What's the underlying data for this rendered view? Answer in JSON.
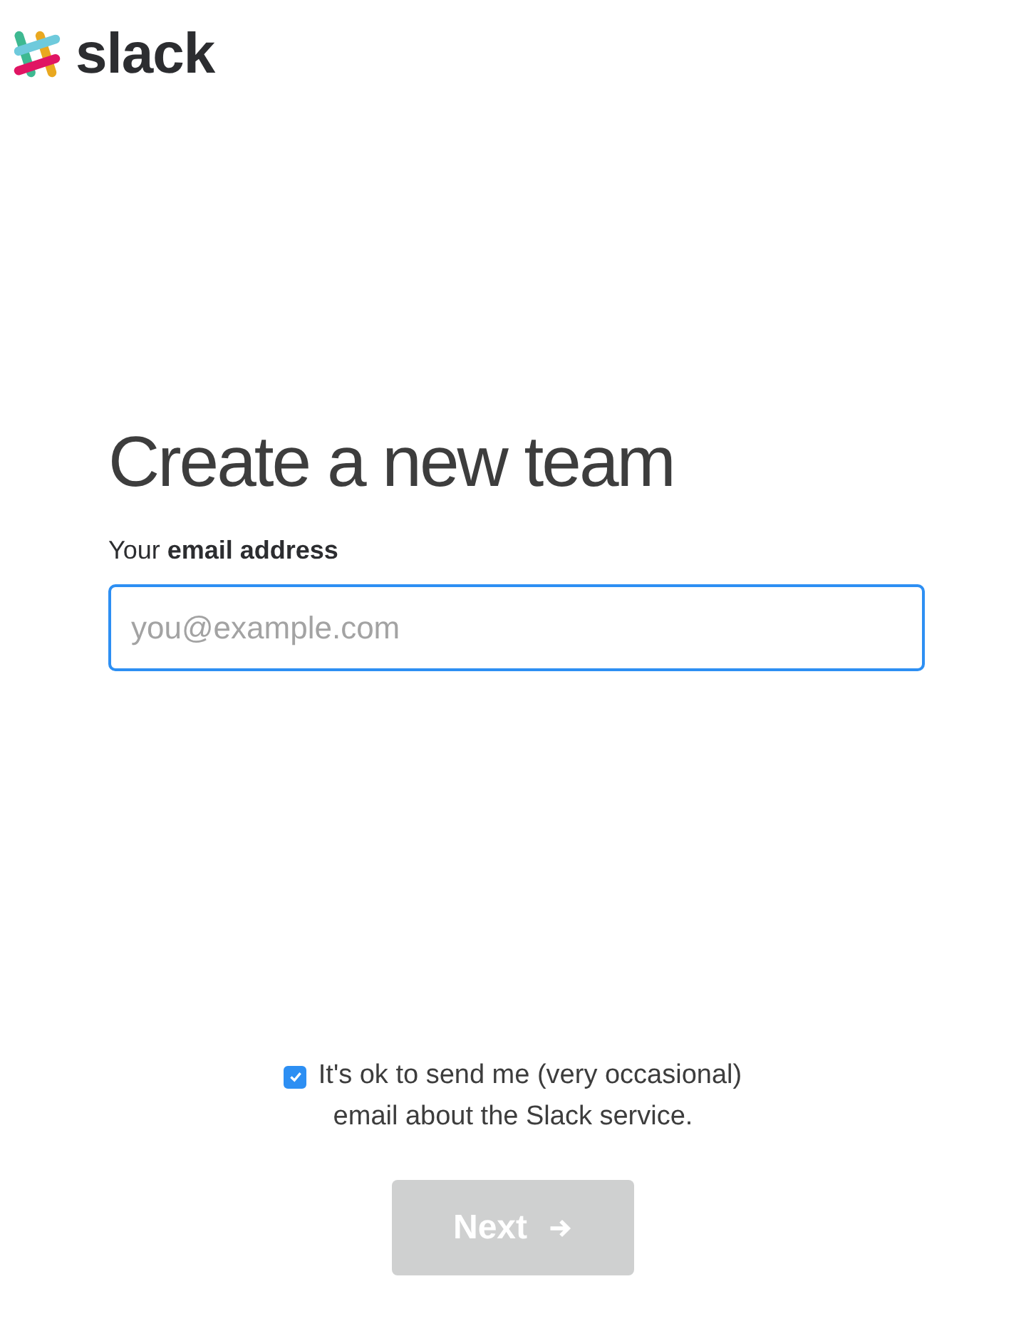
{
  "logo": {
    "text": "slack"
  },
  "heading": "Create a new team",
  "email_field": {
    "label": "Your **email address**",
    "placeholder": "you@example.com",
    "focused": true
  },
  "consent": {
    "label": "It's ok to send me (very occasional) email about the Slack service.",
    "checked": true
  },
  "next_button": {
    "label": "Next",
    "disabled": true
  }
}
